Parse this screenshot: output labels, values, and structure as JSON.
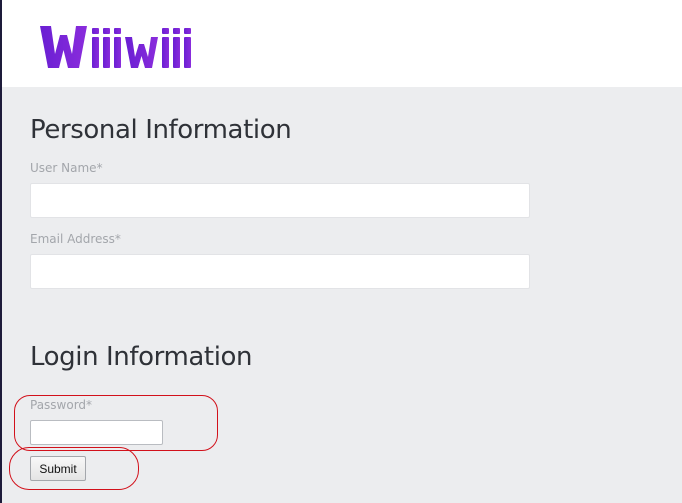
{
  "brand": {
    "logo_text": "Wiiiwiii",
    "logo_color": "#7b22d6"
  },
  "personal_section": {
    "title": "Personal Information",
    "username_label": "User Name*",
    "username_value": "",
    "email_label": "Email Address*",
    "email_value": ""
  },
  "login_section": {
    "title": "Login Information",
    "password_label": "Password*",
    "password_value": "",
    "submit_label": "Submit"
  },
  "colors": {
    "page_background": "#ecedef",
    "header_background": "#ffffff",
    "highlight": "#d2111b"
  }
}
